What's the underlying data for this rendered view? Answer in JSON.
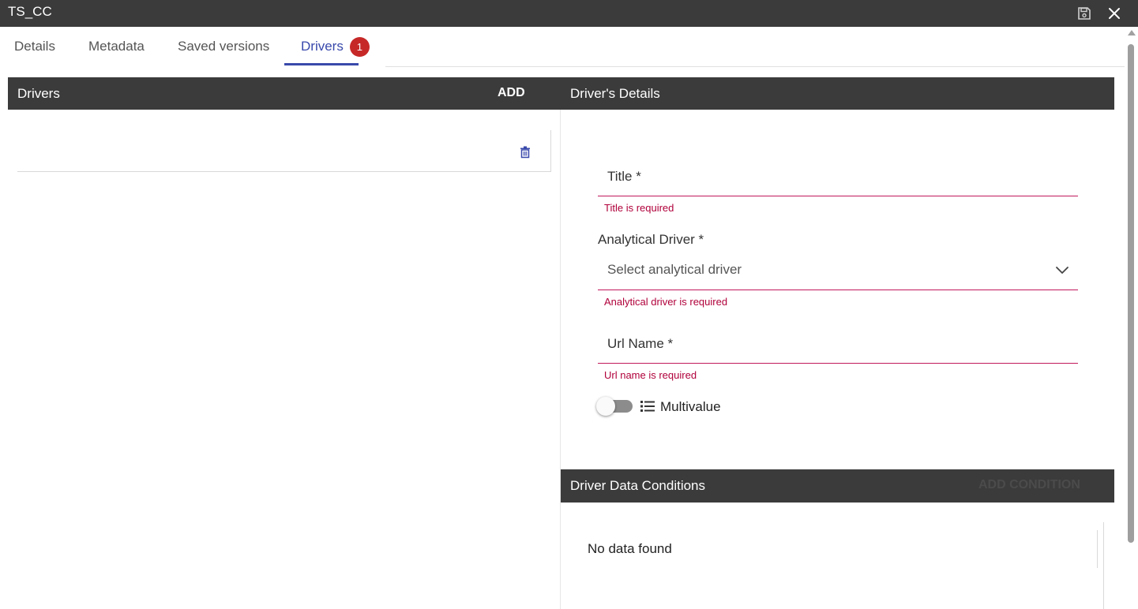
{
  "window": {
    "title": "TS_CC"
  },
  "tabs": [
    {
      "label": "Details"
    },
    {
      "label": "Metadata"
    },
    {
      "label": "Saved versions"
    },
    {
      "label": "Drivers",
      "badge": "1",
      "active": true
    }
  ],
  "drivers_panel": {
    "header": "Drivers",
    "add_label": "ADD"
  },
  "details_panel": {
    "header": "Driver's Details",
    "title_field": {
      "label": "Title *",
      "error": "Title is required"
    },
    "analytical_driver": {
      "label": "Analytical Driver *",
      "placeholder": "Select analytical driver",
      "error": "Analytical driver is required"
    },
    "url_name_field": {
      "label": "Url Name *",
      "error": "Url name is required"
    },
    "multivalue": {
      "label": "Multivalue",
      "checked": false
    }
  },
  "conditions_panel": {
    "header": "Driver Data Conditions",
    "add_label": "ADD CONDITION",
    "empty_text": "No data found"
  },
  "colors": {
    "header_bg": "#3b3b3b",
    "accent": "#3949ab",
    "error": "#b0003a",
    "badge": "#c62828"
  }
}
